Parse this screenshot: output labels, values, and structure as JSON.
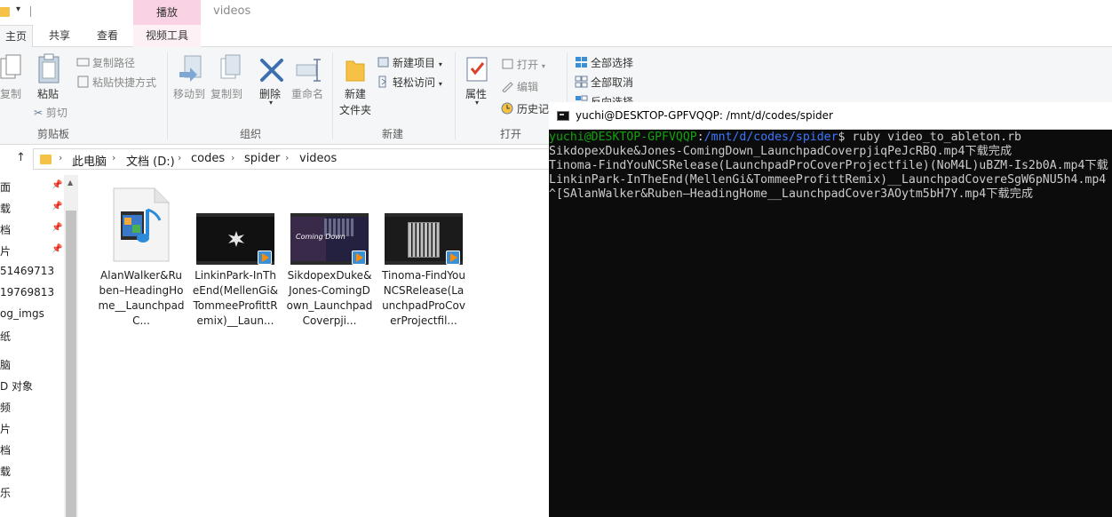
{
  "explorer": {
    "contextual_tab_group": "播放",
    "window_title": "videos",
    "tabs": {
      "home": "主页",
      "share": "共享",
      "view": "查看",
      "video_tools": "视频工具"
    },
    "ribbon": {
      "clipboard": {
        "copy": "复制",
        "paste": "粘贴",
        "copy_path": "复制路径",
        "paste_shortcut": "粘贴快捷方式",
        "cut": "剪切",
        "group_label": "剪贴板"
      },
      "organize": {
        "move_to": "移动到",
        "copy_to": "复制到",
        "delete": "删除",
        "rename": "重命名",
        "group_label": "组织"
      },
      "new": {
        "new_folder_line1": "新建",
        "new_folder_line2": "文件夹",
        "new_item": "新建项目",
        "easy_access": "轻松访问",
        "group_label": "新建"
      },
      "open": {
        "properties": "属性",
        "open": "打开",
        "edit": "编辑",
        "history": "历史记",
        "group_label": "打开"
      },
      "select": {
        "select_all": "全部选择",
        "select_none": "全部取消",
        "invert": "反向选择"
      }
    },
    "address": {
      "crumbs": [
        "此电脑",
        "文档 (D:)",
        "codes",
        "spider",
        "videos"
      ]
    },
    "nav_items": [
      "面",
      "载",
      "档",
      "片",
      "51469713",
      "19769813",
      "og_imgs",
      "纸",
      "脑",
      "D 对象",
      "频",
      "片",
      "档",
      "载",
      "乐"
    ],
    "files": [
      {
        "name": "AlanWalker&Ruben–HeadingHome__LaunchpadC...",
        "type": "audio"
      },
      {
        "name": "LinkinPark-InTheEnd(MellenGi&TommeeProfittRemix)__Laun...",
        "type": "video"
      },
      {
        "name": "SikdopexDuke&Jones-ComingDown_LaunchpadCoverpji...",
        "type": "video",
        "overlay": "Coming Down"
      },
      {
        "name": "Tinoma-FindYouNCSRelease(LaunchpadProCoverProjectfil...",
        "type": "video"
      }
    ]
  },
  "terminal": {
    "title": "yuchi@DESKTOP-GPFVQQP: /mnt/d/codes/spider",
    "prompt_user": "yuchi@DESKTOP-GPFVQQP",
    "prompt_path": "/mnt/d/codes/spider",
    "command": "$ ruby video_to_ableton.rb",
    "lines": [
      "SikdopexDuke&Jones-ComingDown_LaunchpadCoverpjiqPeJcRBQ.mp4下载完成",
      "Tinoma-FindYouNCSRelease(LaunchpadProCoverProjectfile)(NoM4L)uBZM-Is2b0A.mp4下载",
      "LinkinPark-InTheEnd(MellenGi&TommeeProfittRemix)__LaunchpadCovereSgW6pNU5h4.mp4",
      "^[SAlanWalker&Ruben–HeadingHome__LaunchpadCover3AOytm5bH7Y.mp4下载完成"
    ]
  },
  "colors": {
    "ribbon_bg": "#f5f6f7",
    "contextual_tab": "#f9d3e4",
    "terminal_bg": "#0c0c0c",
    "terminal_text": "#cccccc",
    "prompt_green": "#13a10e",
    "prompt_blue": "#3b78ff"
  }
}
